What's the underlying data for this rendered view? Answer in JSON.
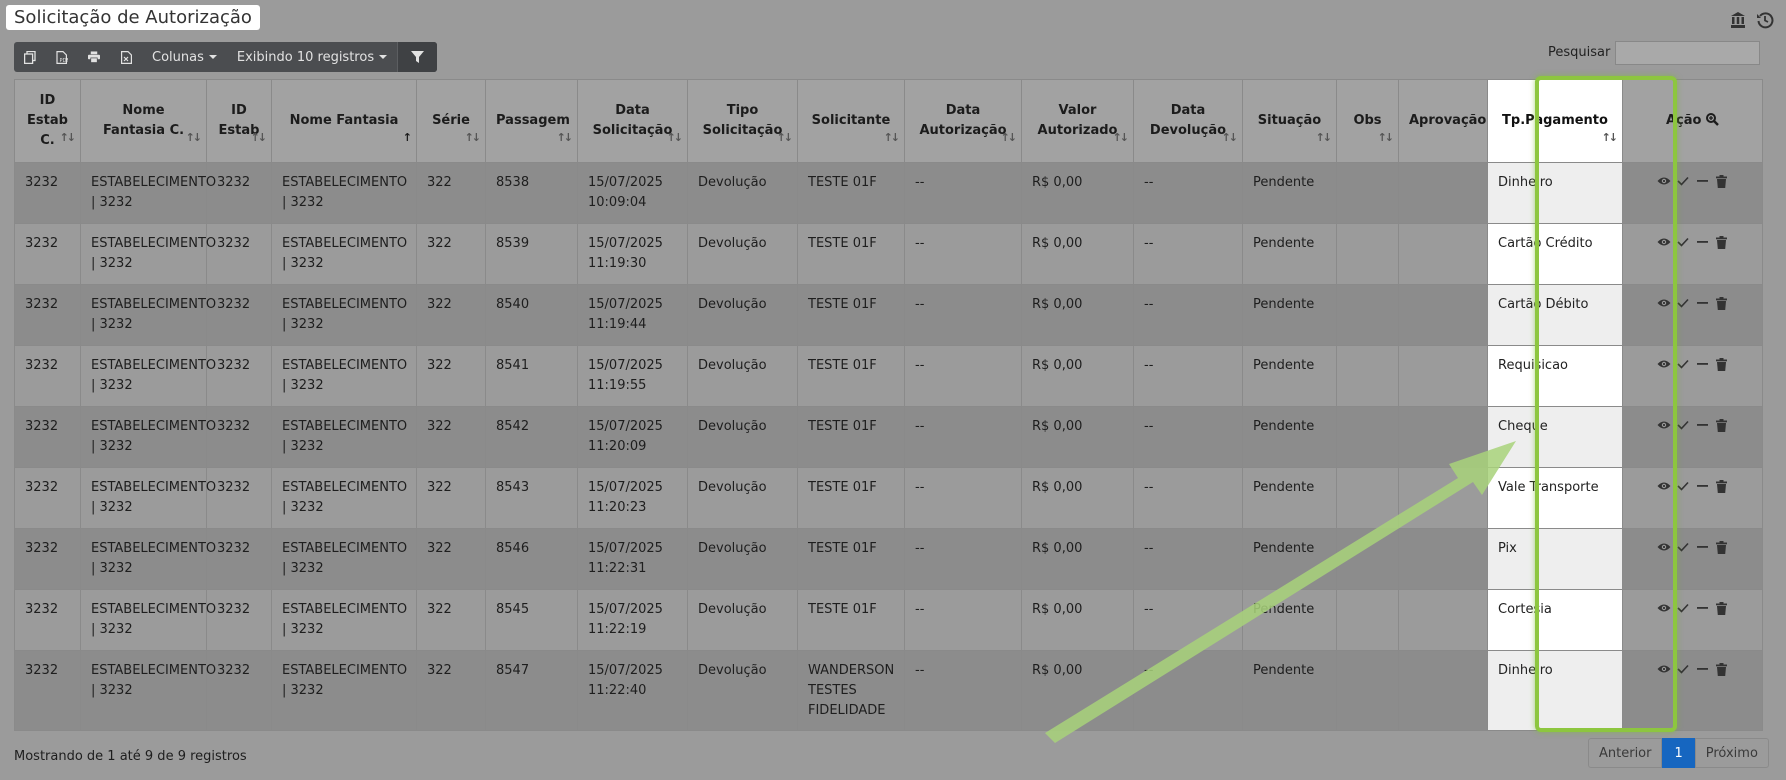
{
  "page": {
    "title": "Solicitação de Autorização"
  },
  "toolbar": {
    "columns_label": "Colunas",
    "display_label": "Exibindo 10 registros"
  },
  "search": {
    "label": "Pesquisar",
    "value": ""
  },
  "table": {
    "headers": [
      "ID Estab C.",
      "Nome Fantasia C.",
      "ID Estab",
      "Nome Fantasia",
      "Série",
      "Passagem",
      "Data Solicitação",
      "Tipo Solicitação",
      "Solicitante",
      "Data Autorização",
      "Valor Autorizado",
      "Data Devolução",
      "Situação",
      "Obs",
      "Aprovação",
      "Tp.Pagamento",
      "Ação"
    ],
    "rows": [
      {
        "id_estab_c": "3232",
        "nome_c": "ESTABELECIMENTO | 3232",
        "id_estab": "3232",
        "nome": "ESTABELECIMENTO | 3232",
        "serie": "322",
        "passagem": "8538",
        "data_sol": "15/07/2025 10:09:04",
        "tipo": "Devolução",
        "solicitante": "TESTE 01F",
        "data_aut": "--",
        "valor": "R$ 0,00",
        "data_dev": "--",
        "situacao": "Pendente",
        "obs": "",
        "aprovacao": "",
        "tp_pag": "Dinheiro"
      },
      {
        "id_estab_c": "3232",
        "nome_c": "ESTABELECIMENTO | 3232",
        "id_estab": "3232",
        "nome": "ESTABELECIMENTO | 3232",
        "serie": "322",
        "passagem": "8539",
        "data_sol": "15/07/2025 11:19:30",
        "tipo": "Devolução",
        "solicitante": "TESTE 01F",
        "data_aut": "--",
        "valor": "R$ 0,00",
        "data_dev": "--",
        "situacao": "Pendente",
        "obs": "",
        "aprovacao": "",
        "tp_pag": "Cartão Crédito"
      },
      {
        "id_estab_c": "3232",
        "nome_c": "ESTABELECIMENTO | 3232",
        "id_estab": "3232",
        "nome": "ESTABELECIMENTO | 3232",
        "serie": "322",
        "passagem": "8540",
        "data_sol": "15/07/2025 11:19:44",
        "tipo": "Devolução",
        "solicitante": "TESTE 01F",
        "data_aut": "--",
        "valor": "R$ 0,00",
        "data_dev": "--",
        "situacao": "Pendente",
        "obs": "",
        "aprovacao": "",
        "tp_pag": "Cartão Débito"
      },
      {
        "id_estab_c": "3232",
        "nome_c": "ESTABELECIMENTO | 3232",
        "id_estab": "3232",
        "nome": "ESTABELECIMENTO | 3232",
        "serie": "322",
        "passagem": "8541",
        "data_sol": "15/07/2025 11:19:55",
        "tipo": "Devolução",
        "solicitante": "TESTE 01F",
        "data_aut": "--",
        "valor": "R$ 0,00",
        "data_dev": "--",
        "situacao": "Pendente",
        "obs": "",
        "aprovacao": "",
        "tp_pag": "Requisicao"
      },
      {
        "id_estab_c": "3232",
        "nome_c": "ESTABELECIMENTO | 3232",
        "id_estab": "3232",
        "nome": "ESTABELECIMENTO | 3232",
        "serie": "322",
        "passagem": "8542",
        "data_sol": "15/07/2025 11:20:09",
        "tipo": "Devolução",
        "solicitante": "TESTE 01F",
        "data_aut": "--",
        "valor": "R$ 0,00",
        "data_dev": "--",
        "situacao": "Pendente",
        "obs": "",
        "aprovacao": "",
        "tp_pag": "Cheque"
      },
      {
        "id_estab_c": "3232",
        "nome_c": "ESTABELECIMENTO | 3232",
        "id_estab": "3232",
        "nome": "ESTABELECIMENTO | 3232",
        "serie": "322",
        "passagem": "8543",
        "data_sol": "15/07/2025 11:20:23",
        "tipo": "Devolução",
        "solicitante": "TESTE 01F",
        "data_aut": "--",
        "valor": "R$ 0,00",
        "data_dev": "--",
        "situacao": "Pendente",
        "obs": "",
        "aprovacao": "",
        "tp_pag": "Vale Transporte"
      },
      {
        "id_estab_c": "3232",
        "nome_c": "ESTABELECIMENTO | 3232",
        "id_estab": "3232",
        "nome": "ESTABELECIMENTO | 3232",
        "serie": "322",
        "passagem": "8546",
        "data_sol": "15/07/2025 11:22:31",
        "tipo": "Devolução",
        "solicitante": "TESTE 01F",
        "data_aut": "--",
        "valor": "R$ 0,00",
        "data_dev": "--",
        "situacao": "Pendente",
        "obs": "",
        "aprovacao": "",
        "tp_pag": "Pix"
      },
      {
        "id_estab_c": "3232",
        "nome_c": "ESTABELECIMENTO | 3232",
        "id_estab": "3232",
        "nome": "ESTABELECIMENTO | 3232",
        "serie": "322",
        "passagem": "8545",
        "data_sol": "15/07/2025 11:22:19",
        "tipo": "Devolução",
        "solicitante": "TESTE 01F",
        "data_aut": "--",
        "valor": "R$ 0,00",
        "data_dev": "--",
        "situacao": "Pendente",
        "obs": "",
        "aprovacao": "",
        "tp_pag": "Cortesia"
      },
      {
        "id_estab_c": "3232",
        "nome_c": "ESTABELECIMENTO | 3232",
        "id_estab": "3232",
        "nome": "ESTABELECIMENTO | 3232",
        "serie": "322",
        "passagem": "8547",
        "data_sol": "15/07/2025 11:22:40",
        "tipo": "Devolução",
        "solicitante": "WANDERSON TESTES FIDELIDADE",
        "data_aut": "--",
        "valor": "R$ 0,00",
        "data_dev": "--",
        "situacao": "Pendente",
        "obs": "",
        "aprovacao": "",
        "tp_pag": "Dinheiro"
      }
    ]
  },
  "footer": {
    "info": "Mostrando de 1 até 9 de 9 registros"
  },
  "pagination": {
    "prev": "Anterior",
    "current": "1",
    "next": "Próximo"
  },
  "colors": {
    "highlight": "#8dc63f",
    "pager_active": "#1666c0",
    "toolbar": "#4b4d50"
  },
  "icons": {
    "toolbar": [
      "copy-icon",
      "export-icon",
      "print-icon",
      "excel-icon",
      "filter-icon"
    ],
    "top": [
      "bank-icon",
      "history-icon"
    ],
    "row_actions": [
      "view-icon",
      "approve-icon",
      "dash-icon",
      "trash-icon"
    ],
    "header_action": "zoom-icon"
  }
}
